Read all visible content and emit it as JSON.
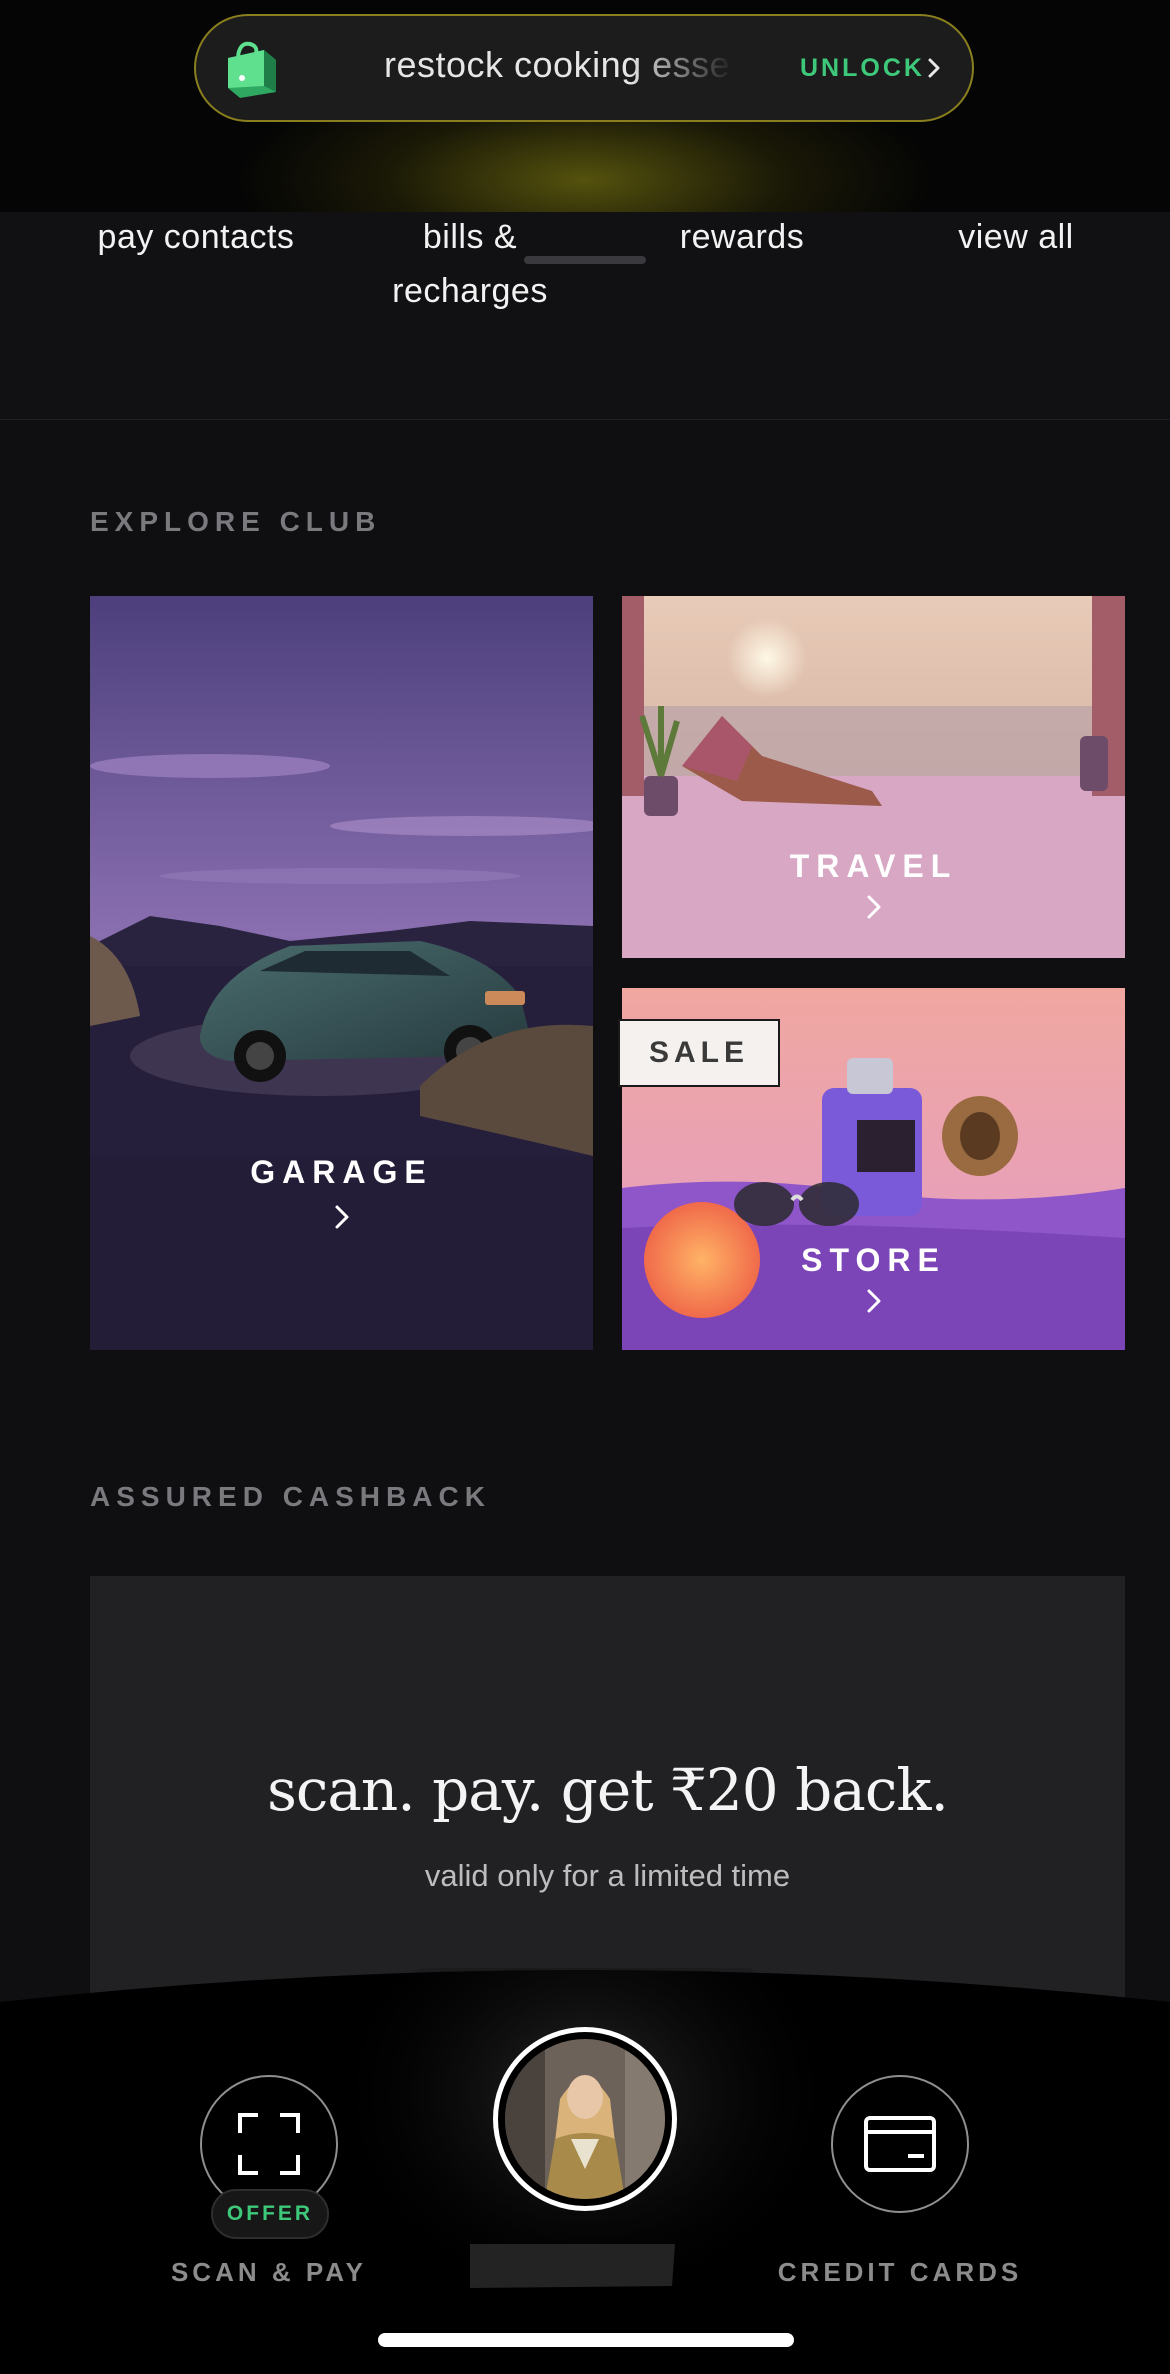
{
  "banner": {
    "text": "restock cooking essentials",
    "action_label": "UNLOCK",
    "accent": "#3ec97a",
    "icon": "shopping-bag-icon"
  },
  "quick_actions": [
    {
      "label": "pay contacts"
    },
    {
      "label": "bills & recharges"
    },
    {
      "label": "rewards"
    },
    {
      "label": "view all"
    }
  ],
  "explore_club": {
    "title": "EXPLORE CLUB",
    "cards": [
      {
        "label": "GARAGE"
      },
      {
        "label": "TRAVEL"
      },
      {
        "label": "STORE",
        "badge": "SALE"
      }
    ]
  },
  "assured_cashback": {
    "title": "ASSURED CASHBACK",
    "headline": "scan. pay. get ₹20 back.",
    "subtext": "valid only for a limited time"
  },
  "bottom_nav": {
    "scan_pay": {
      "label": "SCAN & PAY",
      "badge": "OFFER",
      "icon": "scan-icon"
    },
    "profile": {
      "icon": "avatar"
    },
    "credit_cards": {
      "label": "CREDIT CARDS",
      "icon": "credit-card-icon"
    }
  }
}
